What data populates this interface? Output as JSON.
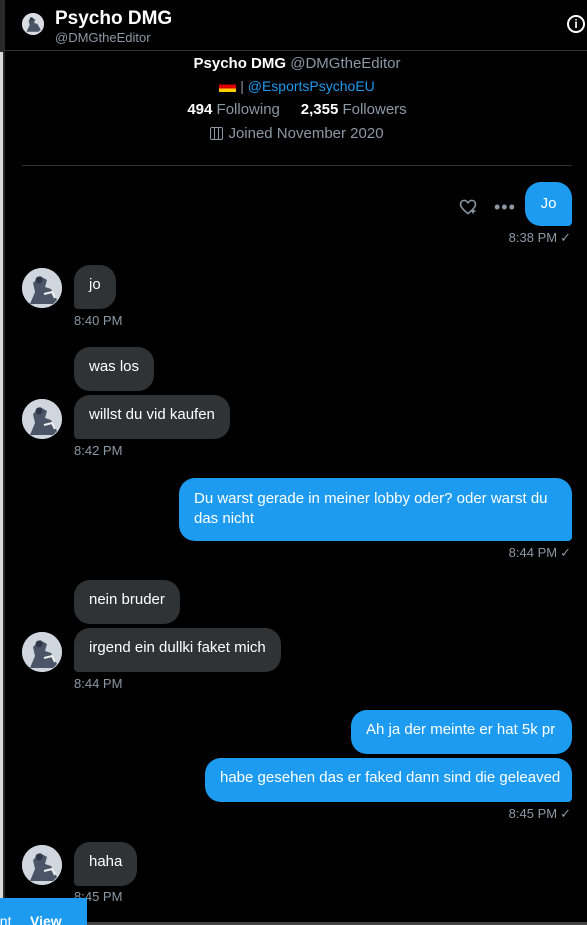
{
  "header": {
    "name": "Psycho DMG",
    "handle": "@DMGtheEditor",
    "info_icon": "i"
  },
  "profile": {
    "name": "Psycho DMG",
    "handle": "@DMGtheEditor",
    "flag": "germany-flag",
    "separator": "|",
    "link": "@EsportsPsychoEU",
    "following_count": "494",
    "following_label": "Following",
    "followers_count": "2,355",
    "followers_label": "Followers",
    "joined": "Joined November 2020"
  },
  "messages": [
    {
      "from": "me",
      "text": "Jo",
      "time": "8:38 PM"
    },
    {
      "from": "them",
      "text": "jo",
      "time": "8:40 PM"
    },
    {
      "from": "them",
      "text": "was los"
    },
    {
      "from": "them",
      "text": "willst du vid kaufen",
      "time": "8:42 PM"
    },
    {
      "from": "me",
      "text": "Du warst gerade in meiner lobby oder? oder warst du das nicht",
      "time": "8:44 PM"
    },
    {
      "from": "them",
      "text": "nein bruder"
    },
    {
      "from": "them",
      "text": "irgend ein dullki faket mich",
      "time": "8:44 PM"
    },
    {
      "from": "me",
      "text": "Ah ja der meinte er hat 5k pr"
    },
    {
      "from": "me",
      "text": "habe gesehen das er faked dann sind die geleaved",
      "time": "8:45 PM"
    },
    {
      "from": "them",
      "text": "haha",
      "time": "8:45 PM"
    }
  ],
  "message_actions": {
    "more": "•••"
  },
  "toast": {
    "text": "ent",
    "view_label": "View"
  },
  "colors": {
    "accent": "#1d9bf0",
    "received_bubble": "#2f3336",
    "muted": "#8b98a5",
    "background": "#000000"
  }
}
